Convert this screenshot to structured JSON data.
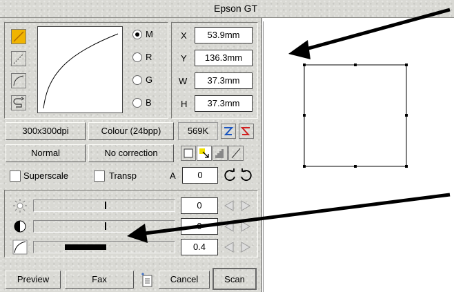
{
  "window": {
    "title": "Epson GT"
  },
  "coords": {
    "x_label": "X",
    "x_value": "53.9mm",
    "y_label": "Y",
    "y_value": "136.3mm",
    "w_label": "W",
    "w_value": "37.3mm",
    "h_label": "H",
    "h_value": "37.3mm"
  },
  "channels": [
    {
      "label": "M",
      "selected": true
    },
    {
      "label": "R",
      "selected": false
    },
    {
      "label": "G",
      "selected": false
    },
    {
      "label": "B",
      "selected": false
    }
  ],
  "settings": {
    "resolution": "300x300dpi",
    "colour_mode": "Colour (24bpp)",
    "size": "569K",
    "quality": "Normal",
    "correction": "No correction"
  },
  "options": {
    "superscale_label": "Superscale",
    "transp_label": "Transp",
    "angle_label": "A",
    "angle_value": "0"
  },
  "sliders": [
    {
      "icon": "brightness-icon",
      "value": "0",
      "position": 0.5
    },
    {
      "icon": "contrast-icon",
      "value": "0",
      "position": 0.5
    },
    {
      "icon": "gamma-icon",
      "value": "0.4",
      "position": 0.3
    }
  ],
  "buttons": {
    "preview": "Preview",
    "fax": "Fax",
    "cancel": "Cancel",
    "scan": "Scan"
  },
  "colors": {
    "accent": "#f0b400",
    "arrow": "#000000"
  }
}
